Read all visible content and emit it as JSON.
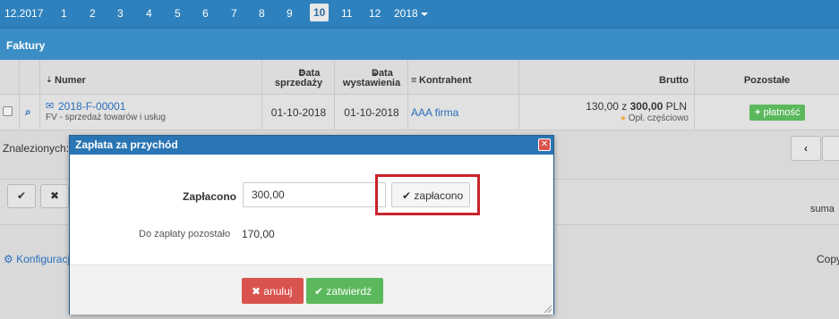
{
  "monthbar": {
    "period": "12.2017",
    "months": [
      "1",
      "2",
      "3",
      "4",
      "5",
      "6",
      "7",
      "8",
      "9",
      "10",
      "11",
      "12"
    ],
    "active_month": "10",
    "year": "2018"
  },
  "section": {
    "title": "Faktury"
  },
  "table": {
    "headers": {
      "numer": "Numer",
      "data_sprzedazy_1": "Data",
      "data_sprzedazy_2": "sprzedaży",
      "data_wystawienia_1": "Data",
      "data_wystawienia_2": "wystawienia",
      "kontrahent": "Kontrahent",
      "brutto": "Brutto",
      "pozostale": "Pozostałe"
    },
    "row": {
      "numer": "2018-F-00001",
      "opis": "FV - sprzedaż towarów i usług",
      "data_sprzedazy": "01-10-2018",
      "data_wystawienia": "01-10-2018",
      "kontrahent": "AAA firma",
      "brutto_paid": "130,00 z",
      "brutto_total": "300,00",
      "currency": "PLN",
      "status": "Opł. częściowo",
      "payment_button": "płatność"
    }
  },
  "background": {
    "found_label": "Znalezionych:",
    "suma": "suma",
    "konfiguracja": "Konfiguracja",
    "copy": "Copy"
  },
  "modal": {
    "title": "Zapłata za przychód",
    "paid_label": "Zapłacono",
    "paid_value": "300,00",
    "paid_button": "zapłacono",
    "remaining_label": "Do zapłaty pozostało",
    "remaining_value": "170,00",
    "cancel_button": "anuluj",
    "confirm_button": "zatwierdź"
  },
  "colors": {
    "primary": "#2e81bd",
    "danger": "#d9534f",
    "success": "#5cb85c",
    "highlight": "#c8242b"
  }
}
